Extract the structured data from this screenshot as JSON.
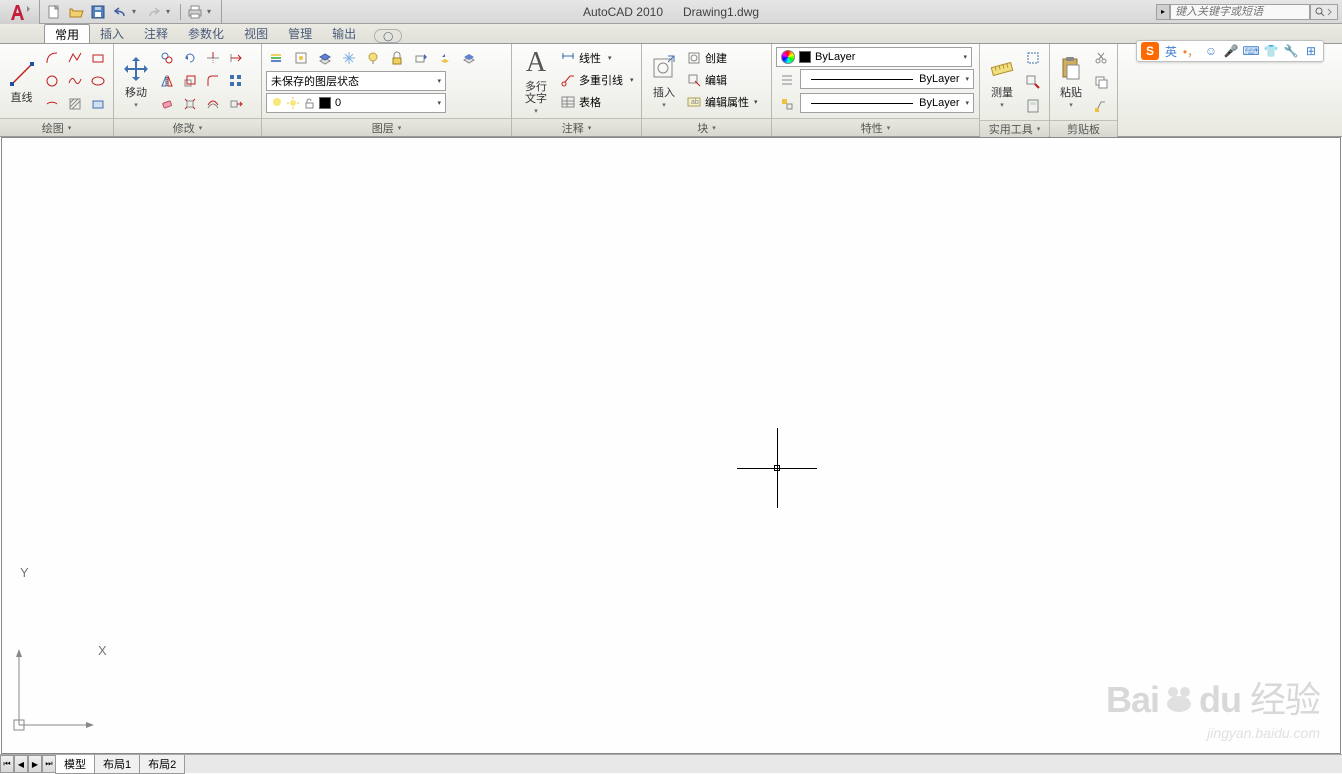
{
  "title": {
    "app": "AutoCAD 2010",
    "file": "Drawing1.dwg"
  },
  "search": {
    "placeholder": "键入关键字或短语"
  },
  "tabs": {
    "items": [
      "常用",
      "插入",
      "注释",
      "参数化",
      "视图",
      "管理",
      "输出"
    ],
    "active": 0
  },
  "panels": {
    "draw": {
      "title": "绘图",
      "main_label": "直线"
    },
    "modify": {
      "title": "修改",
      "main_label": "移动"
    },
    "layer": {
      "title": "图层",
      "state_combo": "未保存的图层状态",
      "current_layer": "0"
    },
    "annotate": {
      "title": "注释",
      "main_label": "多行\n文字",
      "line": "线性",
      "mleader": "多重引线",
      "table": "表格"
    },
    "block": {
      "title": "块",
      "main_label": "插入",
      "create": "创建",
      "edit": "编辑",
      "attrib": "编辑属性"
    },
    "props": {
      "title": "特性",
      "color": "ByLayer",
      "lweight": "ByLayer",
      "ltype": "ByLayer"
    },
    "utils": {
      "title": "实用工具",
      "measure": "测量"
    },
    "clip": {
      "title": "剪贴板",
      "paste": "粘贴"
    }
  },
  "sheets": {
    "items": [
      "模型",
      "布局1",
      "布局2"
    ],
    "active": 0
  },
  "ucs": {
    "x": "X",
    "y": "Y"
  },
  "ime": {
    "logo": "S",
    "lang": "英"
  },
  "watermark": {
    "main": "Baidu 经验",
    "sub": "jingyan.baidu.com"
  }
}
